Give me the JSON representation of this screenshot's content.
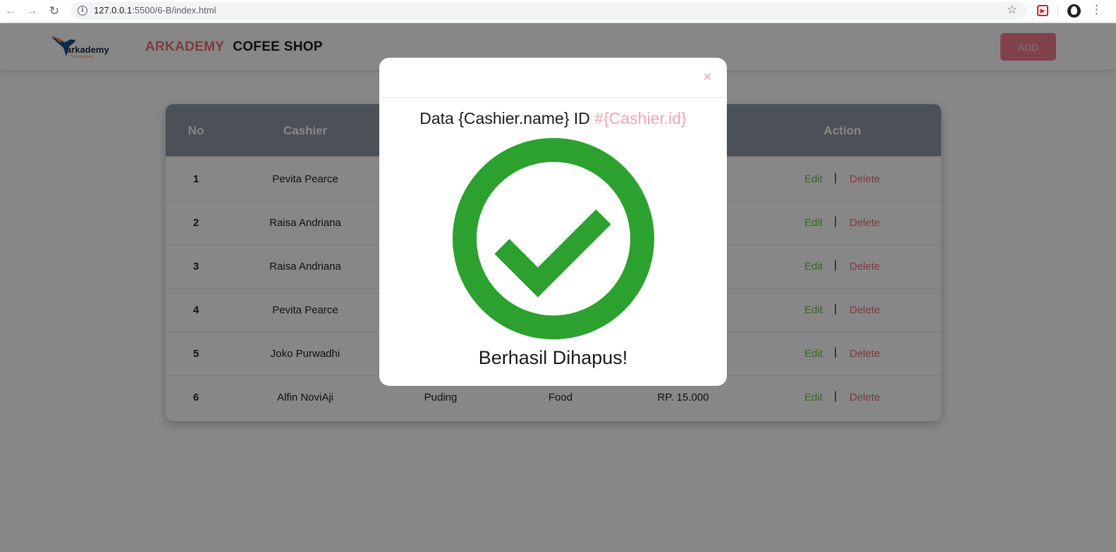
{
  "browser": {
    "url_host": "127.0.0.1",
    "url_rest": ":5500/6-B/index.html"
  },
  "navbar": {
    "logo_text": "arkademy",
    "logo_sub": "Tech Academy",
    "brand_primary": "ARKADEMY",
    "brand_secondary": "COFEE SHOP",
    "add_label": "ADD"
  },
  "table": {
    "headers": [
      "No",
      "Cashier",
      "",
      "",
      "",
      "Action"
    ],
    "rows": [
      {
        "no": "1",
        "cashier": "Pevita Pearce",
        "product": "",
        "category": "",
        "price": ""
      },
      {
        "no": "2",
        "cashier": "Raisa Andriana",
        "product": "",
        "category": "",
        "price": ""
      },
      {
        "no": "3",
        "cashier": "Raisa Andriana",
        "product": "",
        "category": "",
        "price": ""
      },
      {
        "no": "4",
        "cashier": "Pevita Pearce",
        "product": "",
        "category": "",
        "price": ""
      },
      {
        "no": "5",
        "cashier": "Joko Purwadhi",
        "product": "",
        "category": "",
        "price": ""
      },
      {
        "no": "6",
        "cashier": "Alfin NoviAji",
        "product": "Puding",
        "category": "Food",
        "price": "RP. 15.000"
      }
    ],
    "edit_label": "Edit",
    "separator": "|",
    "delete_label": "Delete"
  },
  "modal": {
    "close_symbol": "×",
    "title_prefix": "Data {Cashier.name} ID ",
    "title_id": "#{Cashier.id}",
    "message": "Berhasil Dihapus!"
  },
  "colors": {
    "brand_pink": "#e8707f",
    "success_green": "#2ca12f",
    "edit_green": "#6cc24a",
    "delete_pink": "#f06c83"
  }
}
